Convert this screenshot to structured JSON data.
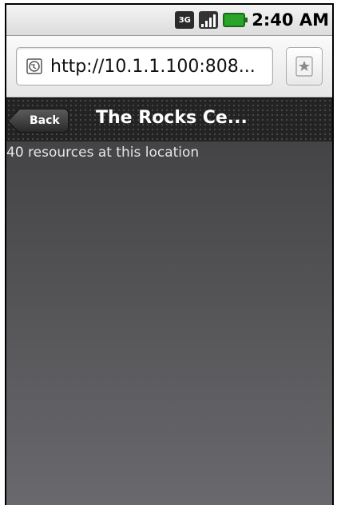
{
  "status_bar": {
    "network_label": "3G",
    "time": "2:40 AM",
    "icons": [
      "3g-icon",
      "signal-icon",
      "battery-icon"
    ]
  },
  "browser": {
    "url": "http://10.1.1.100:808...",
    "bookmark_icon": "star-bookmark-icon"
  },
  "header": {
    "back_label": "Back",
    "title": "The Rocks Ce..."
  },
  "content": {
    "resource_count_text": "40 resources at this location"
  },
  "colors": {
    "header_bg": "#232323",
    "content_top": "#444446",
    "content_bottom": "#6a6a6e"
  }
}
